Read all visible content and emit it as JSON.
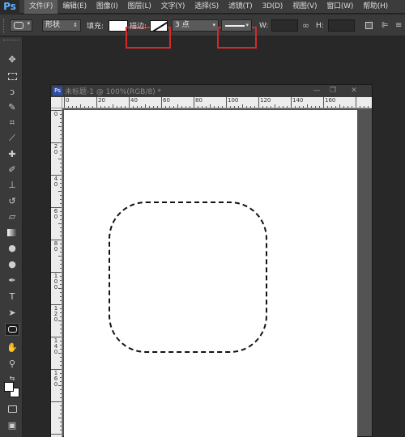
{
  "app": {
    "logo": "Ps"
  },
  "menu": [
    {
      "label": "文件(F)",
      "active": true
    },
    {
      "label": "编辑(E)"
    },
    {
      "label": "图像(I)"
    },
    {
      "label": "图层(L)"
    },
    {
      "label": "文字(Y)"
    },
    {
      "label": "选择(S)"
    },
    {
      "label": "滤镜(T)"
    },
    {
      "label": "3D(D)"
    },
    {
      "label": "视图(V)"
    },
    {
      "label": "窗口(W)"
    },
    {
      "label": "帮助(H)"
    }
  ],
  "options": {
    "mode_value": "形状",
    "fill_label": "填充:",
    "stroke_label": "描边:",
    "stroke_width": "3 点",
    "w_label": "W:",
    "h_label": "H:",
    "highlight_color": "#d42a2a"
  },
  "document": {
    "title": "未标题-1 @ 100%(RGB/8) *",
    "minimize": "—",
    "restore": "❐",
    "close": "✕",
    "hruler_labels": [
      "0",
      "20",
      "40",
      "60",
      "80",
      "100",
      "120",
      "140",
      "160"
    ],
    "vruler_labels": [
      "0",
      "2\n0",
      "4\n0",
      "6\n0",
      "8\n0",
      "1\n0\n0",
      "1\n2\n0",
      "1\n4\n0",
      "1\n6\n0"
    ]
  },
  "tools": [
    "move-tool",
    "marquee-tool",
    "lasso-tool",
    "quick-select-tool",
    "crop-tool",
    "eyedropper-tool",
    "healing-tool",
    "brush-tool",
    "stamp-tool",
    "history-brush-tool",
    "eraser-tool",
    "gradient-tool",
    "blur-tool",
    "dodge-tool",
    "pen-tool",
    "type-tool",
    "path-select-tool",
    "shape-tool",
    "hand-tool",
    "zoom-tool"
  ]
}
